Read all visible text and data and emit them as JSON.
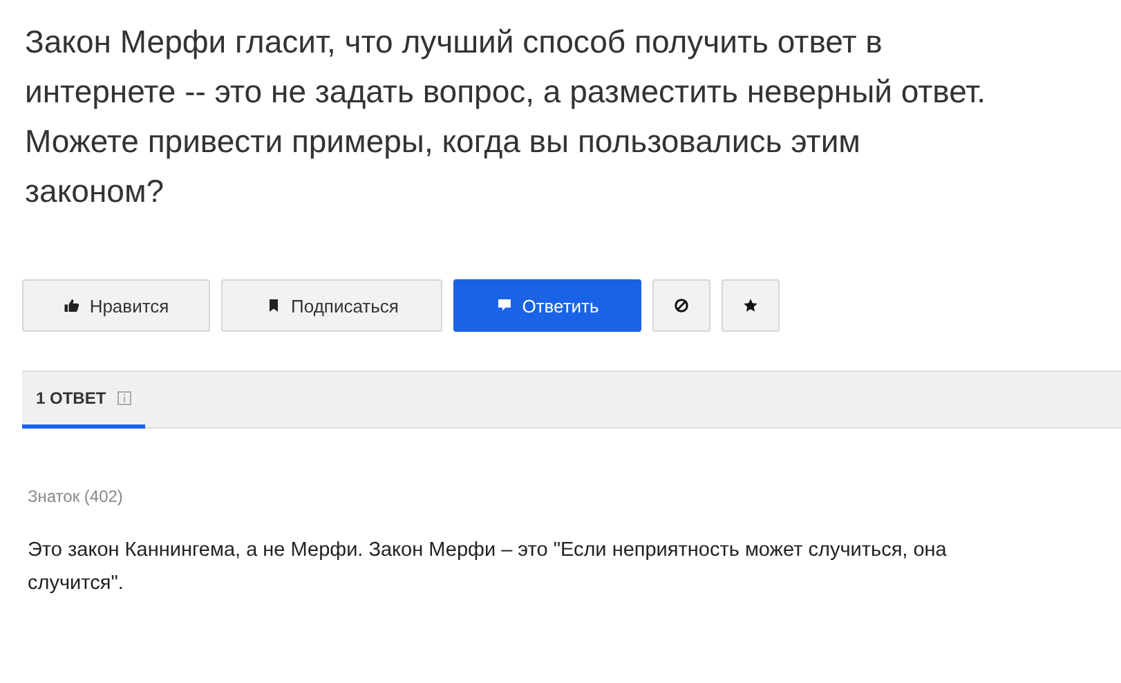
{
  "question": {
    "title": "Закон Мерфи гласит, что лучший способ получить ответ в интернете -- это не задать вопрос, а разместить неверный ответ. Можете привести примеры, когда вы пользовались этим законом?"
  },
  "actions": [
    {
      "kind": "default",
      "label": "Нравится"
    },
    {
      "kind": "default",
      "label": "Подписаться"
    },
    {
      "kind": "primary",
      "label": "Ответить"
    },
    {
      "kind": "icon"
    },
    {
      "kind": "icon"
    }
  ],
  "answers_tab": {
    "label": "1 ОТВЕТ",
    "selected": true
  },
  "answer": {
    "author": "Знаток (402)",
    "text": "Это закон Каннингема, а не Мерфи. Закон Мерфи – это \"Если неприятность может случиться, она случится\"."
  }
}
